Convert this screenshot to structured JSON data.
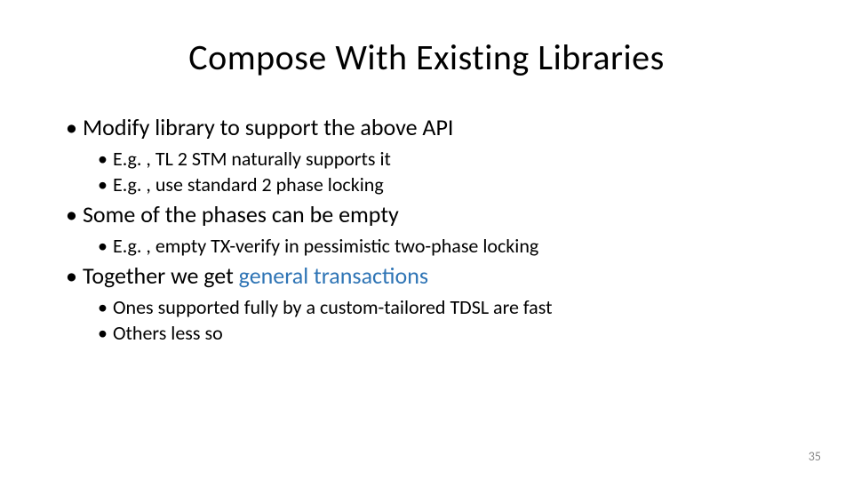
{
  "title": "Compose With Existing Libraries",
  "bullets": {
    "b1": "Modify library to support the above API",
    "b1_1": "E.g. , TL 2 STM naturally supports it",
    "b1_2": "E.g. , use standard 2 phase locking",
    "b2": "Some of the phases can be empty",
    "b2_1": "E.g. , empty TX-verify in pessimistic two-phase locking",
    "b3_pre": "Together we get ",
    "b3_highlight": "general transactions",
    "b3_1": "Ones supported fully by a custom-tailored TDSL are fast",
    "b3_2": "Others less so"
  },
  "bullet_char": "•",
  "page_number": "35"
}
